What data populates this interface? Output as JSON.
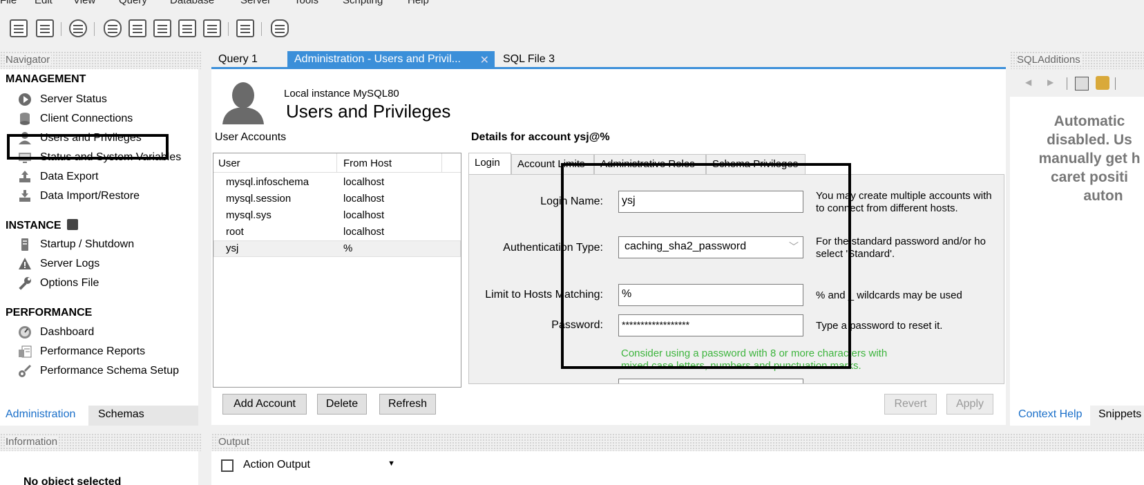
{
  "menu": [
    "File",
    "Edit",
    "View",
    "Query",
    "Database",
    "Server",
    "Tools",
    "Scripting",
    "Help"
  ],
  "navigator": {
    "title": "Navigator",
    "management_title": "MANAGEMENT",
    "management": [
      "Server Status",
      "Client Connections",
      "Users and Privileges",
      "Status and System Variables",
      "Data Export",
      "Data Import/Restore"
    ],
    "instance_title": "INSTANCE",
    "instance": [
      "Startup / Shutdown",
      "Server Logs",
      "Options File"
    ],
    "performance_title": "PERFORMANCE",
    "performance": [
      "Dashboard",
      "Performance Reports",
      "Performance Schema Setup"
    ],
    "tabs": [
      "Administration",
      "Schemas"
    ]
  },
  "information": {
    "title": "Information",
    "message": "No object selected"
  },
  "doc_tabs": [
    "Query 1",
    "Administration - Users and Privil...",
    "SQL File 3"
  ],
  "header": {
    "instance": "Local instance MySQL80",
    "title": "Users and Privileges"
  },
  "accounts": {
    "title": "User Accounts",
    "columns": [
      "User",
      "From Host"
    ],
    "rows": [
      {
        "user": "mysql.infoschema",
        "host": "localhost"
      },
      {
        "user": "mysql.session",
        "host": "localhost"
      },
      {
        "user": "mysql.sys",
        "host": "localhost"
      },
      {
        "user": "root",
        "host": "localhost"
      },
      {
        "user": "ysj",
        "host": "%"
      }
    ],
    "buttons": [
      "Add Account",
      "Delete",
      "Refresh"
    ]
  },
  "details": {
    "title": "Details for account ysj@%",
    "tabs": [
      "Login",
      "Account Limits",
      "Administrative Roles",
      "Schema Privileges"
    ],
    "login_name_label": "Login Name:",
    "login_name": "ysj",
    "login_help": [
      "You may create multiple accounts with",
      "to connect from different hosts."
    ],
    "auth_label": "Authentication Type:",
    "auth_value": "caching_sha2_password",
    "auth_help": [
      "For the standard password and/or ho",
      "select 'Standard'."
    ],
    "hosts_label": "Limit to Hosts Matching:",
    "hosts_value": "%",
    "hosts_help": "% and _ wildcards may be used",
    "password_label": "Password:",
    "password_value": "******************",
    "password_help": "Type a password to reset it.",
    "warning": [
      "Consider using a password with 8 or more characters with",
      "mixed case letters, numbers and punctuation marks."
    ],
    "buttons": [
      "Revert",
      "Apply"
    ]
  },
  "sql_additions": {
    "title": "SQLAdditions",
    "message": [
      "Automatic",
      "disabled. Us",
      "manually get h",
      "caret positi",
      "auton"
    ],
    "tabs": [
      "Context Help",
      "Snippets"
    ]
  },
  "output": {
    "title": "Output",
    "selector": "Action Output"
  },
  "colors": {
    "accent": "#3b8fd9",
    "link": "#1a6fc9",
    "warning_text": "#3cb43c"
  }
}
